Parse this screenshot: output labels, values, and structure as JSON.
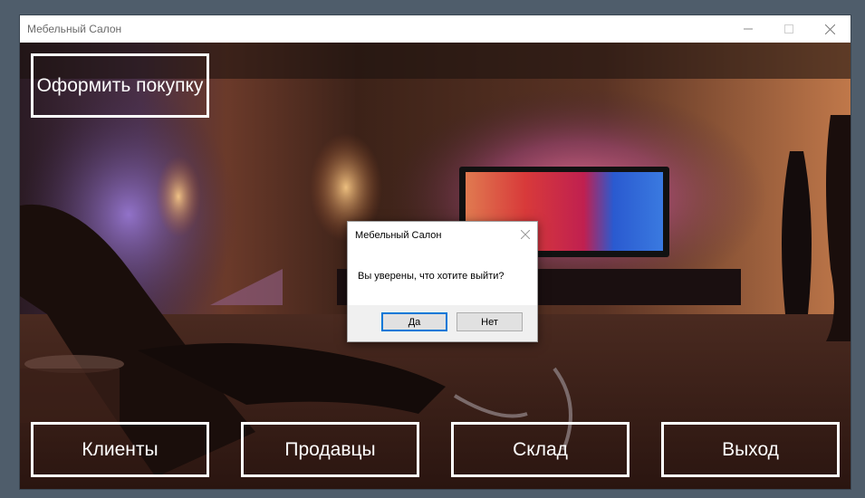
{
  "window": {
    "title": "Мебельный Салон"
  },
  "buttons": {
    "buy": "Оформить покупку",
    "clients": "Клиенты",
    "sellers": "Продавцы",
    "stock": "Склад",
    "exit": "Выход"
  },
  "dialog": {
    "title": "Мебельный Салон",
    "message": "Вы уверены, что хотите выйти?",
    "yes": "Да",
    "no": "Нет"
  }
}
